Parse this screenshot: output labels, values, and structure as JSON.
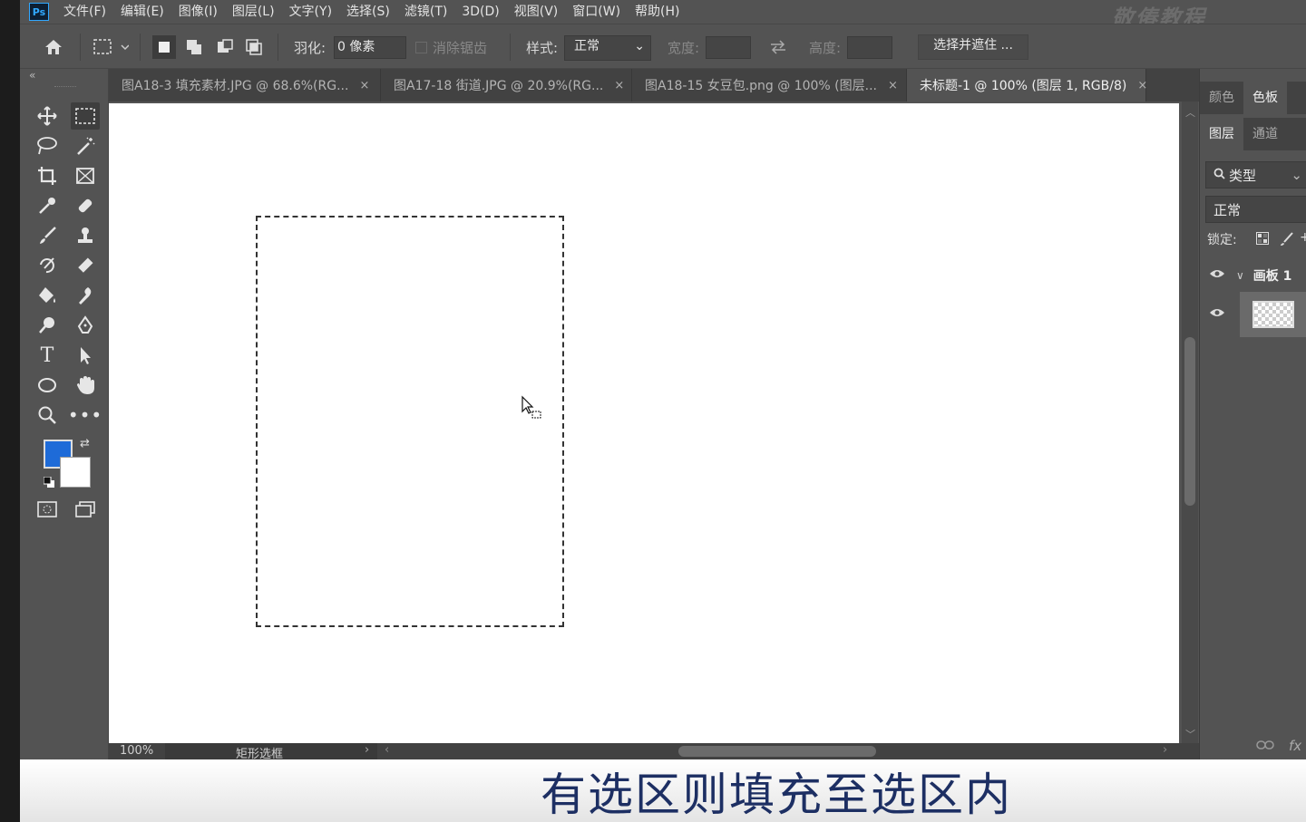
{
  "app": {
    "logo": "Ps",
    "watermark": "敬偆教程"
  },
  "menu": [
    "文件(F)",
    "编辑(E)",
    "图像(I)",
    "图层(L)",
    "文字(Y)",
    "选择(S)",
    "滤镜(T)",
    "3D(D)",
    "视图(V)",
    "窗口(W)",
    "帮助(H)"
  ],
  "options": {
    "feather_label": "羽化:",
    "feather_value": "0 像素",
    "antialias_label": "消除锯齿",
    "style_label": "样式:",
    "style_value": "正常",
    "width_label": "宽度:",
    "height_label": "高度:",
    "select_mask_button": "选择并遮住 ..."
  },
  "tabs": [
    {
      "label": "图A18-3 填充素材.JPG @ 68.6%(RG...",
      "close": "×"
    },
    {
      "label": "图A17-18 街道.JPG @ 20.9%(RG...",
      "close": "×"
    },
    {
      "label": "图A18-15 女豆包.png @ 100% (图层...",
      "close": "×"
    },
    {
      "label": "未标题-1 @ 100% (图层 1, RGB/8)",
      "close": "×"
    }
  ],
  "status": {
    "zoom": "100%",
    "tool": "矩形选框"
  },
  "right_panel": {
    "color_tabs": [
      "颜色",
      "色板"
    ],
    "layer_tabs": [
      "图层",
      "通道"
    ],
    "filter": "类型",
    "blend_mode": "正常",
    "lock_label": "锁定:",
    "layers": [
      {
        "name": "画板 1"
      }
    ]
  },
  "colors": {
    "foreground": "#1e6bd8",
    "background": "#ffffff"
  },
  "subtitle": "有选区则填充至选区内"
}
